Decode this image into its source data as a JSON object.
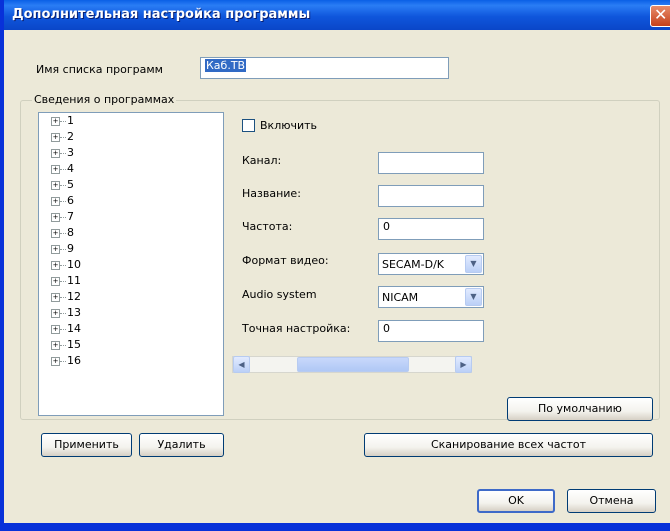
{
  "window": {
    "title": "Дополнительная настройка программы"
  },
  "list_name": {
    "label": "Имя списка программ",
    "value": "Каб.ТВ"
  },
  "programs_group": {
    "title": "Сведения о программах",
    "items": [
      "1",
      "2",
      "3",
      "4",
      "5",
      "6",
      "7",
      "8",
      "9",
      "10",
      "11",
      "12",
      "13",
      "14",
      "15",
      "16"
    ]
  },
  "details": {
    "enable_label": "Включить",
    "enabled": false,
    "channel_label": "Канал:",
    "channel_value": "",
    "name_label": "Название:",
    "name_value": "",
    "frequency_label": "Частота:",
    "frequency_value": "0",
    "video_format_label": "Формат видео:",
    "video_format_value": "SECAM-D/K",
    "audio_system_label": "Audio system",
    "audio_system_value": "NICAM",
    "fine_tune_label": "Точная настройка:",
    "fine_tune_value": "0",
    "fine_tune_slider_level": 0.5
  },
  "buttons": {
    "defaults": "По умолчанию",
    "apply": "Применить",
    "delete": "Удалить",
    "scan_all": "Сканирование всех частот",
    "ok": "OK",
    "cancel": "Отмена"
  },
  "colors": {
    "titlebar": "#0a46c8",
    "selection": "#316ac5"
  }
}
